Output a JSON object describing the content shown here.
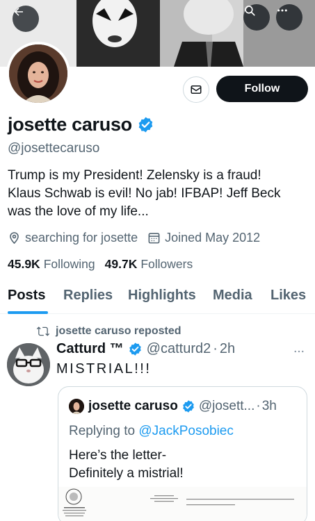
{
  "header": {
    "back_icon": "arrow-left-icon",
    "search_icon": "search-icon",
    "more_icon": "more-horizontal-icon"
  },
  "profile": {
    "name": "josette caruso",
    "handle": "@josettecaruso",
    "bio_line1": "Trump is my President! Zelensky is a fraud!",
    "bio_line2": "Klaus Schwab is evil! No jab! IFBAP! Jeff Beck",
    "bio_line3": "was the love of my life...",
    "location": "searching for josette",
    "joined": "Joined May 2012",
    "following_count": "45.9K",
    "following_label": "Following",
    "followers_count": "49.7K",
    "followers_label": "Followers",
    "follow_button": "Follow",
    "verified_color": "#1d9bf0"
  },
  "tabs": [
    {
      "label": "Posts",
      "active": true
    },
    {
      "label": "Replies"
    },
    {
      "label": "Highlights"
    },
    {
      "label": "Media"
    },
    {
      "label": "Likes"
    }
  ],
  "post": {
    "repost_label": "josette caruso reposted",
    "author_name": "Catturd ™",
    "author_handle": "@catturd2",
    "separator": "·",
    "time": "2h",
    "text": "MISTRIAL!!!",
    "quote": {
      "author_name": "josette caruso",
      "author_handle": "@josett...",
      "separator": "·",
      "time": "3h",
      "replying_prefix": "Replying to ",
      "replying_handle": "@JackPosobiec",
      "text_line1": "Here’s the letter-",
      "text_line2": "Definitely a mistrial!"
    }
  },
  "colors": {
    "accent": "#1d9bf0",
    "text": "#0f1419",
    "secondary": "#536471"
  }
}
